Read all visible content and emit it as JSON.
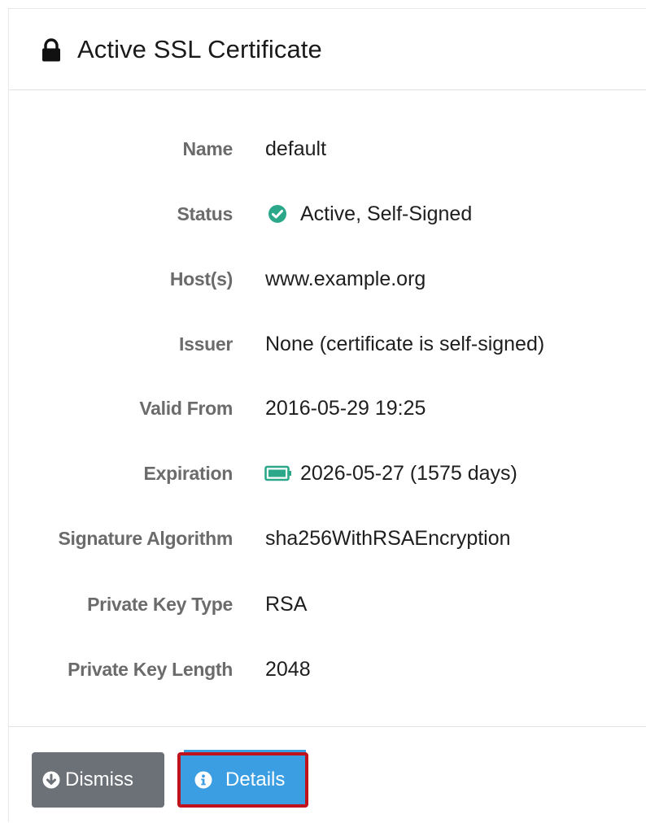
{
  "header": {
    "title": "Active SSL Certificate",
    "icon": "lock-icon"
  },
  "details": [
    {
      "label": "Name",
      "value": "default"
    },
    {
      "label": "Status",
      "value": "Active, Self-Signed",
      "icon": "check-circle-icon",
      "icon_color": "#2aa889"
    },
    {
      "label": "Host(s)",
      "value": "www.example.org"
    },
    {
      "label": "Issuer",
      "value": "None (certificate is self-signed)"
    },
    {
      "label": "Valid From",
      "value": "2016-05-29 19:25"
    },
    {
      "label": "Expiration",
      "value": "2026-05-27 (1575 days)",
      "icon": "battery-full-icon",
      "icon_color": "#2aa889"
    },
    {
      "label": "Signature Algorithm",
      "value": "sha256WithRSAEncryption"
    },
    {
      "label": "Private Key Type",
      "value": "RSA"
    },
    {
      "label": "Private Key Length",
      "value": "2048"
    }
  ],
  "footer": {
    "dismiss_label": "Dismiss",
    "dismiss_icon": "arrow-circle-down-icon",
    "details_label": "Details",
    "details_icon": "info-circle-icon"
  },
  "colors": {
    "accent_green": "#2aa889",
    "dismiss_bg": "#6c7178",
    "details_bg": "#3b9ee2",
    "highlight_border": "#c0121c"
  }
}
